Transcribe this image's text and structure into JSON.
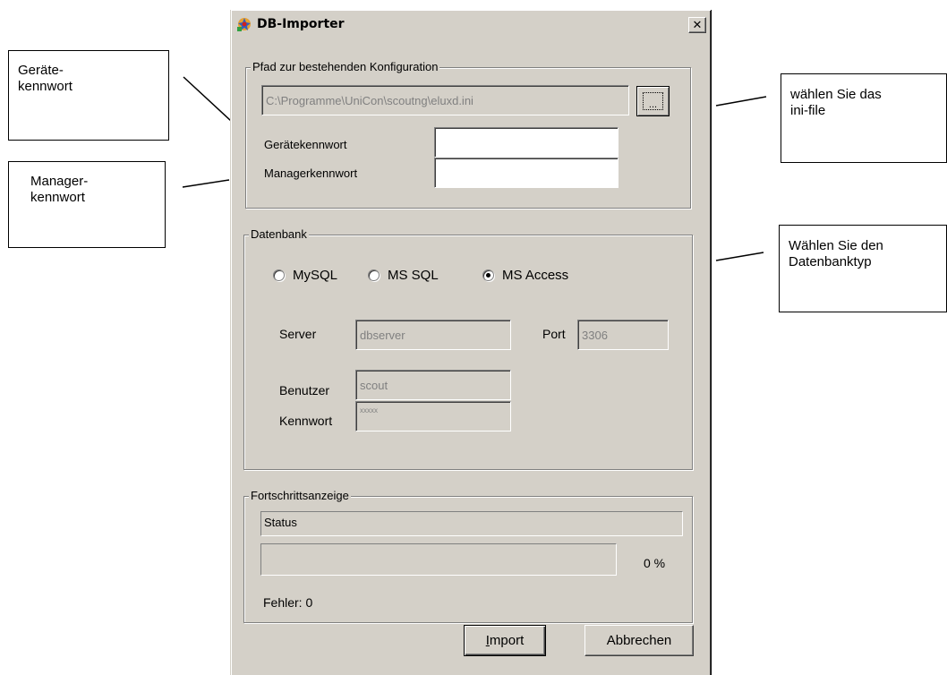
{
  "callouts": {
    "geraetekennwort": "Geräte-\nkennwort",
    "managerkennwort": "Manager-\nkennwort",
    "inifile": "wählen Sie das\nini-file",
    "datenbanktyp": "Wählen Sie den\nDatenbanktyp"
  },
  "window": {
    "title": "DB-Importer",
    "close_label": "✕"
  },
  "config_group": {
    "legend": "Pfad zur bestehenden Konfiguration",
    "path_value": "C:\\Programme\\UniCon\\scoutng\\eluxd.ini",
    "browse_label": "...",
    "device_pw_label": "Gerätekennwort",
    "device_pw_value": "",
    "manager_pw_label": "Managerkennwort",
    "manager_pw_value": ""
  },
  "db_group": {
    "legend": "Datenbank",
    "radios": [
      {
        "label": "MySQL",
        "selected": false
      },
      {
        "label": "MS SQL",
        "selected": false
      },
      {
        "label": "MS Access",
        "selected": true
      }
    ],
    "server_label": "Server",
    "server_value": "dbserver",
    "port_label": "Port",
    "port_value": "3306",
    "user_label": "Benutzer",
    "user_value": "scout",
    "password_label": "Kennwort",
    "password_value": "xxxxx"
  },
  "progress_group": {
    "legend": "Fortschrittsanzeige",
    "status_text": "Status",
    "percent_text": "0 %",
    "progress_value": 0,
    "errors_text": "Fehler: 0"
  },
  "buttons": {
    "import_mnemonic": "I",
    "import_rest": "mport",
    "cancel_label": "Abbrechen"
  }
}
